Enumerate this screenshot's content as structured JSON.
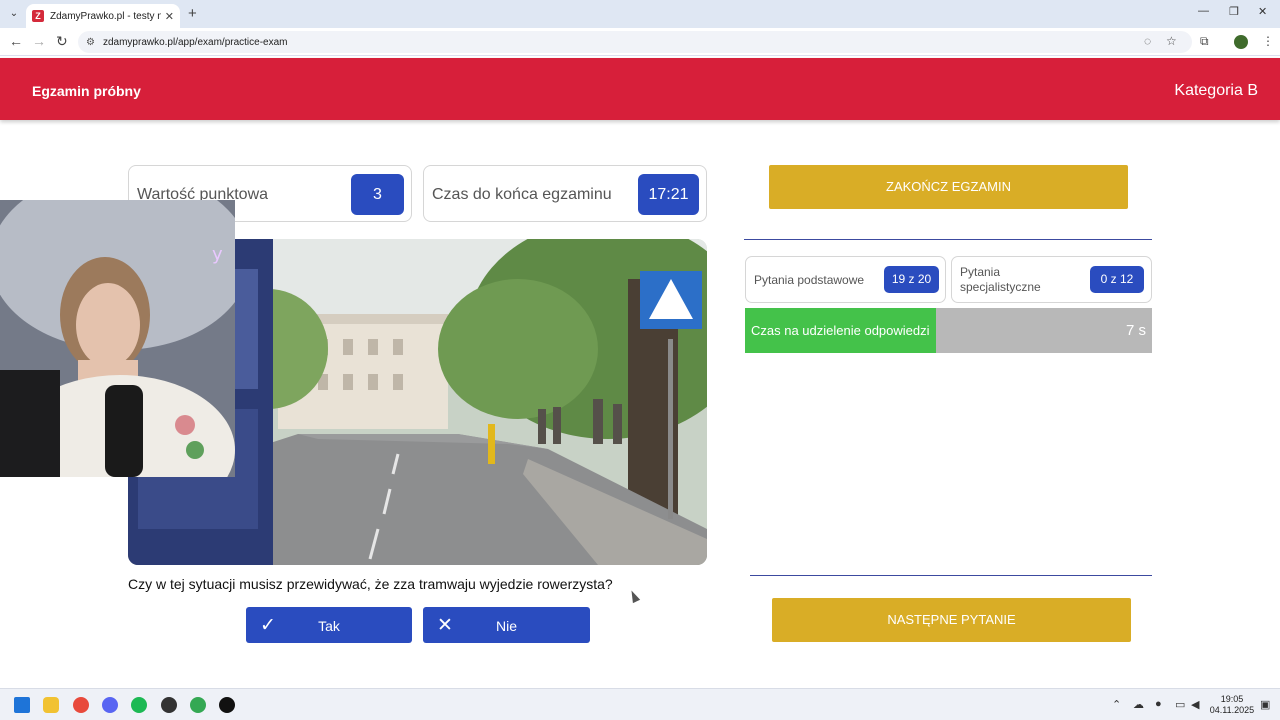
{
  "browser": {
    "tab_title": "ZdamyPrawko.pl - testy na prawo jazdy",
    "favicon_letter": "Z",
    "url": "zdamyprawko.pl/app/exam/practice-exam"
  },
  "header": {
    "title": "Egzamin próbny",
    "category": "Kategoria B"
  },
  "exam": {
    "points_label": "Wartość punktowa",
    "points_value": "3",
    "time_label": "Czas do końca egzaminu",
    "time_value": "17:21",
    "question": "Czy w tej sytuacji musisz przewidywać, że zza tramwaju wyjedzie rowerzysta?",
    "answer_yes": "Tak",
    "answer_no": "Nie"
  },
  "panel": {
    "finish_button": "ZAKOŃCZ EGZAMIN",
    "basic_label": "Pytania podstawowe",
    "basic_value": "19 z 20",
    "specialist_label_1": "Pytania",
    "specialist_label_2": "specjalistyczne",
    "specialist_value": "0 z 12",
    "answer_time_label": "Czas na udzielenie odpowiedzi",
    "answer_time_value": "7 s",
    "answer_time_fraction": 0.47,
    "next_button": "NASTĘPNE PYTANIE"
  },
  "taskbar": {
    "time": "19:05",
    "date": "04.11.2025"
  },
  "colors": {
    "brand_red": "#d71f3a",
    "primary_blue": "#2a4cbf",
    "gold": "#d9ad26",
    "timer_green": "#44c24a"
  }
}
